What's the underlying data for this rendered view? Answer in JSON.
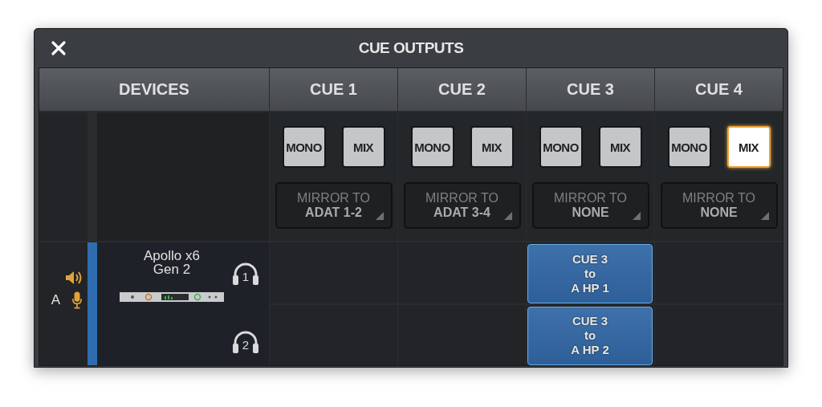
{
  "window": {
    "title": "CUE OUTPUTS"
  },
  "devices_header": "DEVICES",
  "cues": [
    {
      "label": "CUE 1",
      "mono": {
        "label": "MONO",
        "selected": false
      },
      "mix": {
        "label": "MIX",
        "selected": false
      },
      "mirror": {
        "caption": "MIRROR TO",
        "value": "ADAT 1-2"
      }
    },
    {
      "label": "CUE 2",
      "mono": {
        "label": "MONO",
        "selected": false
      },
      "mix": {
        "label": "MIX",
        "selected": false
      },
      "mirror": {
        "caption": "MIRROR TO",
        "value": "ADAT 3-4"
      }
    },
    {
      "label": "CUE 3",
      "mono": {
        "label": "MONO",
        "selected": false
      },
      "mix": {
        "label": "MIX",
        "selected": false
      },
      "mirror": {
        "caption": "MIRROR TO",
        "value": "NONE"
      }
    },
    {
      "label": "CUE 4",
      "mono": {
        "label": "MONO",
        "selected": false
      },
      "mix": {
        "label": "MIX",
        "selected": true
      },
      "mirror": {
        "caption": "MIRROR TO",
        "value": "NONE"
      }
    }
  ],
  "device": {
    "letter": "A",
    "name": "Apollo x6 Gen 2",
    "color": "#2f6db0",
    "outputs": [
      {
        "number": "1",
        "cells": [
          {
            "assigned": false
          },
          {
            "assigned": false
          },
          {
            "assigned": true,
            "lines": [
              "CUE 3",
              "to",
              "A HP 1"
            ]
          },
          {
            "assigned": false
          }
        ]
      },
      {
        "number": "2",
        "cells": [
          {
            "assigned": false
          },
          {
            "assigned": false
          },
          {
            "assigned": true,
            "lines": [
              "CUE 3",
              "to",
              "A HP 2"
            ]
          },
          {
            "assigned": false
          }
        ]
      }
    ]
  }
}
